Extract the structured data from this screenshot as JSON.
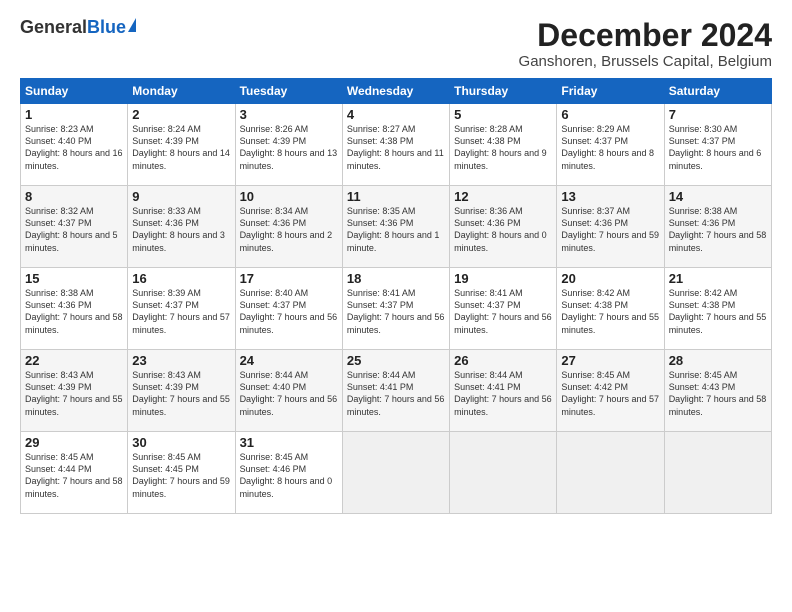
{
  "logo": {
    "general": "General",
    "blue": "Blue"
  },
  "header": {
    "title": "December 2024",
    "subtitle": "Ganshoren, Brussels Capital, Belgium"
  },
  "calendar": {
    "days_of_week": [
      "Sunday",
      "Monday",
      "Tuesday",
      "Wednesday",
      "Thursday",
      "Friday",
      "Saturday"
    ],
    "weeks": [
      [
        {
          "day": "",
          "empty": true
        },
        {
          "day": "",
          "empty": true
        },
        {
          "day": "",
          "empty": true
        },
        {
          "day": "",
          "empty": true
        },
        {
          "day": "",
          "empty": true
        },
        {
          "day": "",
          "empty": true
        },
        {
          "day": "",
          "empty": true
        }
      ],
      [
        {
          "day": "1",
          "sunrise": "Sunrise: 8:23 AM",
          "sunset": "Sunset: 4:40 PM",
          "daylight": "Daylight: 8 hours and 16 minutes."
        },
        {
          "day": "2",
          "sunrise": "Sunrise: 8:24 AM",
          "sunset": "Sunset: 4:39 PM",
          "daylight": "Daylight: 8 hours and 14 minutes."
        },
        {
          "day": "3",
          "sunrise": "Sunrise: 8:26 AM",
          "sunset": "Sunset: 4:39 PM",
          "daylight": "Daylight: 8 hours and 13 minutes."
        },
        {
          "day": "4",
          "sunrise": "Sunrise: 8:27 AM",
          "sunset": "Sunset: 4:38 PM",
          "daylight": "Daylight: 8 hours and 11 minutes."
        },
        {
          "day": "5",
          "sunrise": "Sunrise: 8:28 AM",
          "sunset": "Sunset: 4:38 PM",
          "daylight": "Daylight: 8 hours and 9 minutes."
        },
        {
          "day": "6",
          "sunrise": "Sunrise: 8:29 AM",
          "sunset": "Sunset: 4:37 PM",
          "daylight": "Daylight: 8 hours and 8 minutes."
        },
        {
          "day": "7",
          "sunrise": "Sunrise: 8:30 AM",
          "sunset": "Sunset: 4:37 PM",
          "daylight": "Daylight: 8 hours and 6 minutes."
        }
      ],
      [
        {
          "day": "8",
          "sunrise": "Sunrise: 8:32 AM",
          "sunset": "Sunset: 4:37 PM",
          "daylight": "Daylight: 8 hours and 5 minutes."
        },
        {
          "day": "9",
          "sunrise": "Sunrise: 8:33 AM",
          "sunset": "Sunset: 4:36 PM",
          "daylight": "Daylight: 8 hours and 3 minutes."
        },
        {
          "day": "10",
          "sunrise": "Sunrise: 8:34 AM",
          "sunset": "Sunset: 4:36 PM",
          "daylight": "Daylight: 8 hours and 2 minutes."
        },
        {
          "day": "11",
          "sunrise": "Sunrise: 8:35 AM",
          "sunset": "Sunset: 4:36 PM",
          "daylight": "Daylight: 8 hours and 1 minute."
        },
        {
          "day": "12",
          "sunrise": "Sunrise: 8:36 AM",
          "sunset": "Sunset: 4:36 PM",
          "daylight": "Daylight: 8 hours and 0 minutes."
        },
        {
          "day": "13",
          "sunrise": "Sunrise: 8:37 AM",
          "sunset": "Sunset: 4:36 PM",
          "daylight": "Daylight: 7 hours and 59 minutes."
        },
        {
          "day": "14",
          "sunrise": "Sunrise: 8:38 AM",
          "sunset": "Sunset: 4:36 PM",
          "daylight": "Daylight: 7 hours and 58 minutes."
        }
      ],
      [
        {
          "day": "15",
          "sunrise": "Sunrise: 8:38 AM",
          "sunset": "Sunset: 4:36 PM",
          "daylight": "Daylight: 7 hours and 58 minutes."
        },
        {
          "day": "16",
          "sunrise": "Sunrise: 8:39 AM",
          "sunset": "Sunset: 4:37 PM",
          "daylight": "Daylight: 7 hours and 57 minutes."
        },
        {
          "day": "17",
          "sunrise": "Sunrise: 8:40 AM",
          "sunset": "Sunset: 4:37 PM",
          "daylight": "Daylight: 7 hours and 56 minutes."
        },
        {
          "day": "18",
          "sunrise": "Sunrise: 8:41 AM",
          "sunset": "Sunset: 4:37 PM",
          "daylight": "Daylight: 7 hours and 56 minutes."
        },
        {
          "day": "19",
          "sunrise": "Sunrise: 8:41 AM",
          "sunset": "Sunset: 4:37 PM",
          "daylight": "Daylight: 7 hours and 56 minutes."
        },
        {
          "day": "20",
          "sunrise": "Sunrise: 8:42 AM",
          "sunset": "Sunset: 4:38 PM",
          "daylight": "Daylight: 7 hours and 55 minutes."
        },
        {
          "day": "21",
          "sunrise": "Sunrise: 8:42 AM",
          "sunset": "Sunset: 4:38 PM",
          "daylight": "Daylight: 7 hours and 55 minutes."
        }
      ],
      [
        {
          "day": "22",
          "sunrise": "Sunrise: 8:43 AM",
          "sunset": "Sunset: 4:39 PM",
          "daylight": "Daylight: 7 hours and 55 minutes."
        },
        {
          "day": "23",
          "sunrise": "Sunrise: 8:43 AM",
          "sunset": "Sunset: 4:39 PM",
          "daylight": "Daylight: 7 hours and 55 minutes."
        },
        {
          "day": "24",
          "sunrise": "Sunrise: 8:44 AM",
          "sunset": "Sunset: 4:40 PM",
          "daylight": "Daylight: 7 hours and 56 minutes."
        },
        {
          "day": "25",
          "sunrise": "Sunrise: 8:44 AM",
          "sunset": "Sunset: 4:41 PM",
          "daylight": "Daylight: 7 hours and 56 minutes."
        },
        {
          "day": "26",
          "sunrise": "Sunrise: 8:44 AM",
          "sunset": "Sunset: 4:41 PM",
          "daylight": "Daylight: 7 hours and 56 minutes."
        },
        {
          "day": "27",
          "sunrise": "Sunrise: 8:45 AM",
          "sunset": "Sunset: 4:42 PM",
          "daylight": "Daylight: 7 hours and 57 minutes."
        },
        {
          "day": "28",
          "sunrise": "Sunrise: 8:45 AM",
          "sunset": "Sunset: 4:43 PM",
          "daylight": "Daylight: 7 hours and 58 minutes."
        }
      ],
      [
        {
          "day": "29",
          "sunrise": "Sunrise: 8:45 AM",
          "sunset": "Sunset: 4:44 PM",
          "daylight": "Daylight: 7 hours and 58 minutes."
        },
        {
          "day": "30",
          "sunrise": "Sunrise: 8:45 AM",
          "sunset": "Sunset: 4:45 PM",
          "daylight": "Daylight: 7 hours and 59 minutes."
        },
        {
          "day": "31",
          "sunrise": "Sunrise: 8:45 AM",
          "sunset": "Sunset: 4:46 PM",
          "daylight": "Daylight: 8 hours and 0 minutes."
        },
        {
          "day": "",
          "empty": true
        },
        {
          "day": "",
          "empty": true
        },
        {
          "day": "",
          "empty": true
        },
        {
          "day": "",
          "empty": true
        }
      ]
    ]
  }
}
